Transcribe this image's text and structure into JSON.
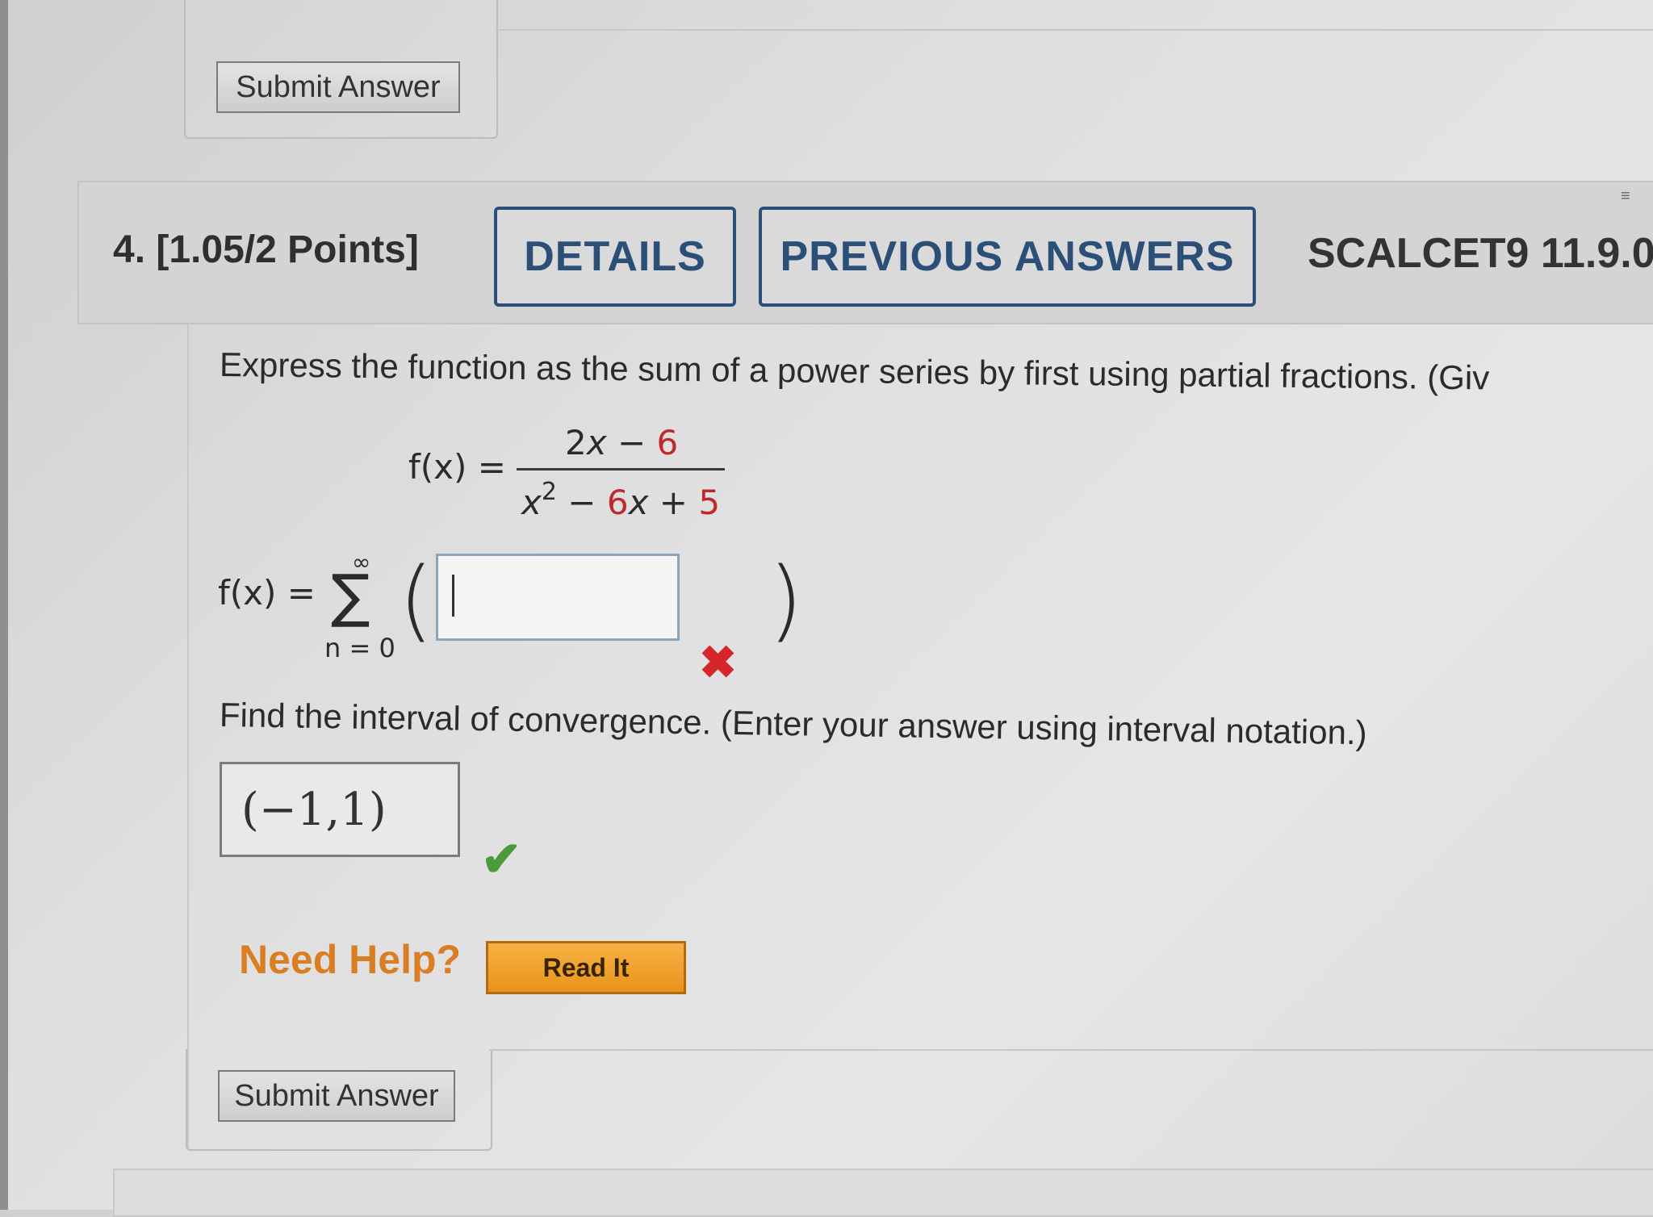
{
  "top": {
    "submit_label": "Submit Answer"
  },
  "question": {
    "number": "4.",
    "points": "[1.05/2 Points]",
    "details_label": "DETAILS",
    "previous_answers_label": "PREVIOUS ANSWERS",
    "reference": "SCALCET9 11.9.0"
  },
  "prompt1": "Express the function as the sum of a power series by first using partial fractions. (Giv",
  "function": {
    "lhs": "f(x) =",
    "numerator_black": "2",
    "numerator_x": "x",
    "numerator_minus": " − ",
    "numerator_const": "6",
    "denominator_x": "x",
    "denominator_exp": "2",
    "denominator_minus": " − ",
    "denominator_coef": "6",
    "denominator_x2": "x",
    "denominator_plus": " + ",
    "denominator_const": "5"
  },
  "series": {
    "lhs": "f(x) =",
    "sigma": "∑",
    "upper": "∞",
    "lower": "n = 0",
    "open_paren": "(",
    "close_paren": ")",
    "answer_value": "",
    "status_icon": "✖"
  },
  "prompt2": "Find the interval of convergence. (Enter your answer using interval notation.)",
  "interval": {
    "value": "(−1,1)",
    "status_icon": "✔"
  },
  "help": {
    "label": "Need Help?",
    "read_it_label": "Read It"
  },
  "bottom": {
    "submit_label": "Submit Answer"
  },
  "colors": {
    "accent_blue": "#2c4f78",
    "wrong_red": "#d7262b",
    "correct_green": "#4c9a3a",
    "help_orange": "#d97e22",
    "read_it_orange": "#e8931a"
  }
}
